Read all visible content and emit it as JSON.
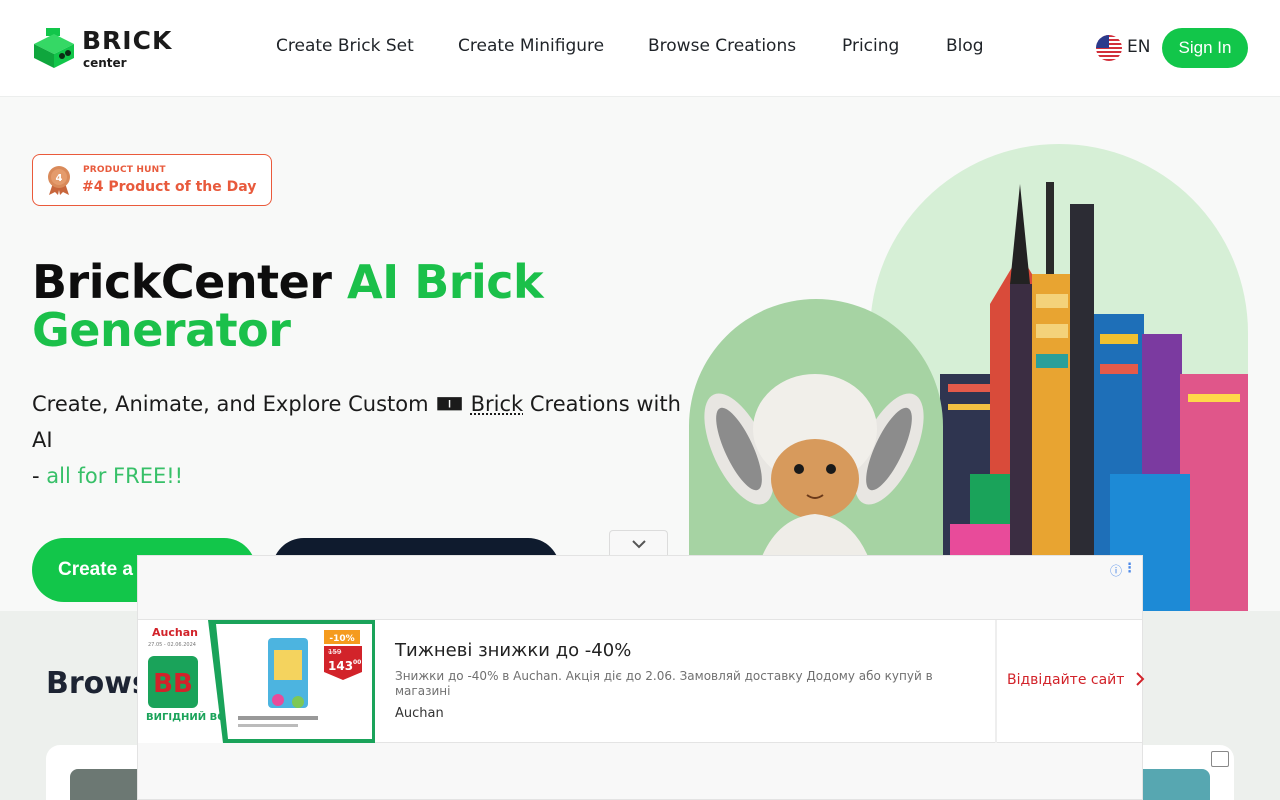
{
  "header": {
    "logo_word": "BRICK",
    "logo_sub": "center",
    "nav": [
      "Create Brick Set",
      "Create Minifigure",
      "Browse Creations",
      "Pricing",
      "Blog"
    ],
    "lang_label": "EN",
    "signin_label": "Sign In"
  },
  "badge": {
    "top": "PRODUCT HUNT",
    "main": "#4 Product of the Day",
    "rank": "4"
  },
  "hero": {
    "title_plain": "BrickCenter ",
    "title_green": "AI Brick Generator",
    "sub_part1": "Create, Animate, and Explore Custom ",
    "sub_icon": "🀰",
    "sub_brick": "Brick",
    "sub_part2": " Creations with AI",
    "sub_dash": "- ",
    "sub_free": "all for FREE!!",
    "cta_green_label": "Create a"
  },
  "lower": {
    "browse_title": "Browse"
  },
  "ad": {
    "headline": "Тижневі знижки до -40%",
    "description": "Знижки до -40% в Auchan. Акція діє до 2.06. Замовляй доставку Додому або купуй в магазині",
    "brand": "Auchan",
    "cta": "Відвідайте сайт",
    "image_brand": "Auchan",
    "image_dates": "27.05 - 02.06.2024",
    "image_badge": "ВИГІДНИЙ ВОЗИК",
    "image_price_old": "159",
    "image_price_new": "143",
    "image_price_cents": "00",
    "image_discount": "-10%"
  },
  "colors": {
    "accent": "#12c64a",
    "dark": "#0f1b2e",
    "ad_cta": "#d2232a",
    "badge": "#ea5a3b"
  }
}
